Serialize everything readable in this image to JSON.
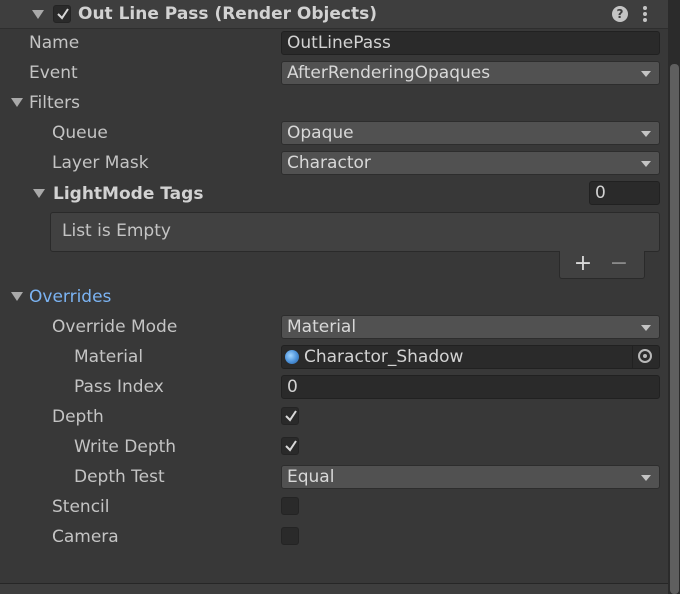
{
  "header": {
    "title": "Out Line Pass (Render Objects)",
    "help_icon": "question-circle-icon",
    "menu_icon": "kebab-menu-icon"
  },
  "fields": {
    "name": {
      "label": "Name",
      "value": "OutLinePass"
    },
    "event": {
      "label": "Event",
      "value": "AfterRenderingOpaques"
    }
  },
  "filters": {
    "label": "Filters",
    "queue": {
      "label": "Queue",
      "value": "Opaque"
    },
    "layer_mask": {
      "label": "Layer Mask",
      "value": "Charactor"
    },
    "lightmode_tags": {
      "label": "LightMode Tags",
      "count": "0",
      "empty_text": "List is Empty",
      "add_label": "+",
      "remove_label": "−"
    }
  },
  "overrides": {
    "label": "Overrides",
    "override_mode": {
      "label": "Override Mode",
      "value": "Material"
    },
    "material": {
      "label": "Material",
      "value": "Charactor_Shadow"
    },
    "pass_index": {
      "label": "Pass Index",
      "value": "0"
    },
    "depth": {
      "label": "Depth",
      "checked": true
    },
    "write_depth": {
      "label": "Write Depth",
      "checked": true
    },
    "depth_test": {
      "label": "Depth Test",
      "value": "Equal"
    },
    "stencil": {
      "label": "Stencil",
      "checked": false
    },
    "camera": {
      "label": "Camera",
      "checked": false
    }
  },
  "colors": {
    "background": "#383838",
    "overrides_label": "#7bb3f2",
    "text": "#c4c4c4"
  }
}
